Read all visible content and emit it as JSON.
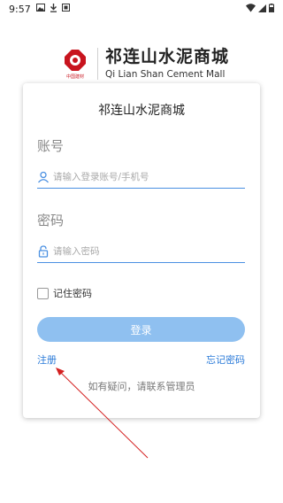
{
  "status_bar": {
    "time": "9:57",
    "left_icons": [
      "image-icon",
      "download-icon",
      "notification-icon"
    ],
    "right_icons": [
      "wifi-icon",
      "signal-icon",
      "battery-icon"
    ]
  },
  "brand": {
    "logo_caption": "中国建材",
    "name_cn": "祁连山水泥商城",
    "name_en": "Qi Lian  Shan Cement Mall",
    "logo_color": "#c8141e"
  },
  "login_card": {
    "title": "祁连山水泥商城",
    "account_label": "账号",
    "account_placeholder": "请输入登录账号/手机号",
    "account_value": "",
    "password_label": "密码",
    "password_placeholder": "请输入密码",
    "password_value": "",
    "remember_label": "记住密码",
    "remember_checked": false,
    "login_button": "登录",
    "register_link": "注册",
    "forgot_link": "忘记密码",
    "help_text": "如有疑问，请联系管理员"
  },
  "colors": {
    "accent": "#4a90e2",
    "button": "#8fc0f0",
    "link": "#2a7ad8",
    "annotation_arrow": "#d42020"
  }
}
